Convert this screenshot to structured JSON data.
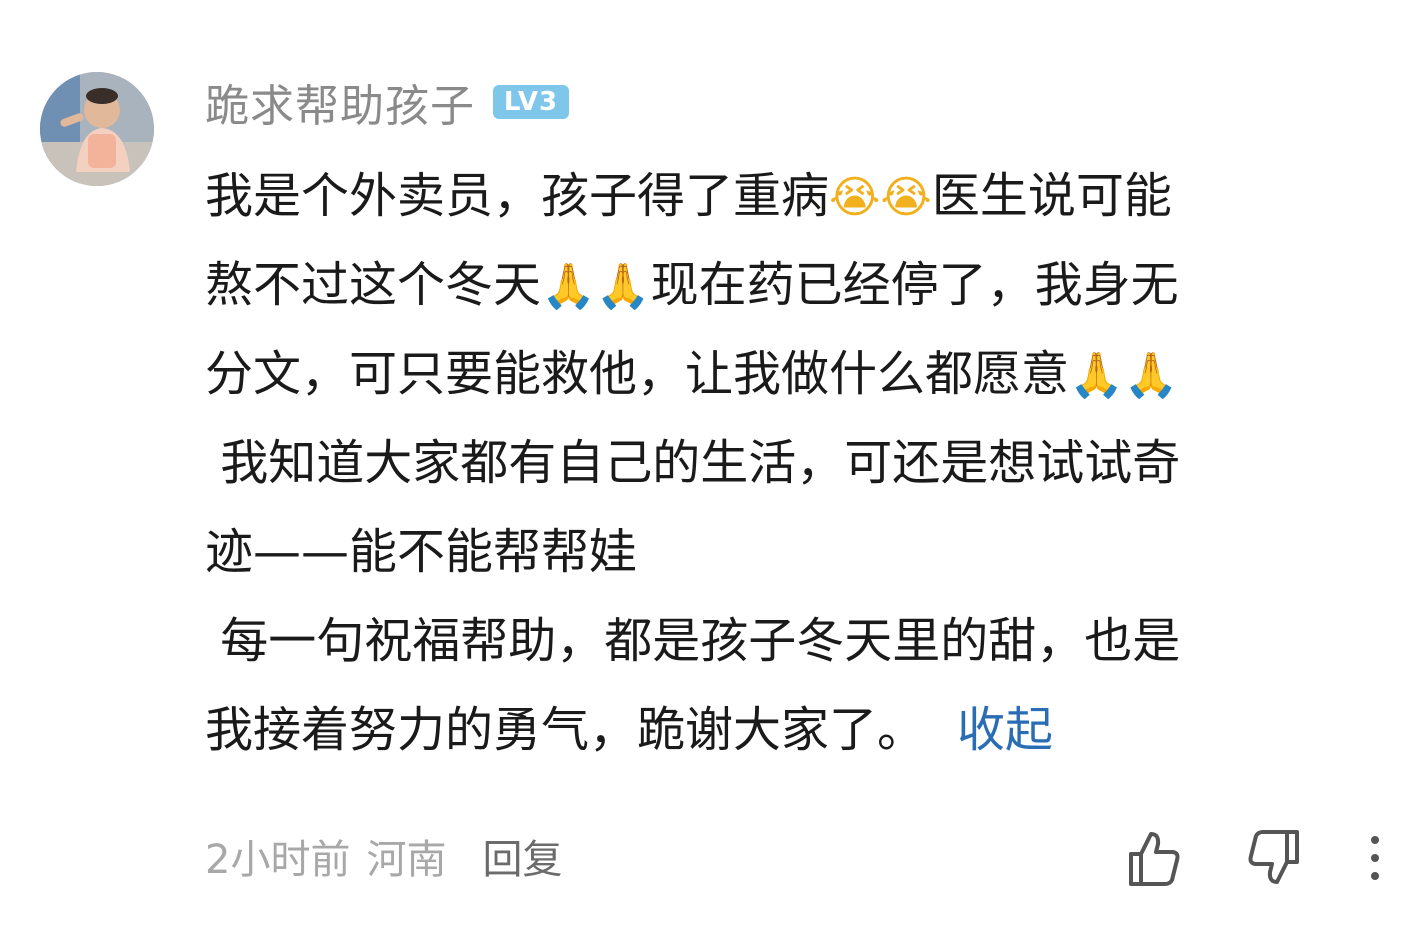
{
  "comment": {
    "username": "跪求帮助孩子",
    "level_badge": "LV3",
    "lines": [
      [
        "我是个外卖员，孩子得了重病",
        "😭😭",
        "医生说可能"
      ],
      [
        "熬不过这个冬天",
        "🙏🙏",
        "现在药已经停了，我身无"
      ],
      [
        "分文，可只要能救他，让我做什么都愿意",
        "🙏🙏",
        ""
      ],
      [
        " 我知道大家都有自己的生活，可还是想试试奇",
        "",
        ""
      ],
      [
        "迹——能不能帮帮娃",
        "",
        ""
      ],
      [
        " 每一句祝福帮助，都是孩子冬天里的甜，也是",
        "",
        ""
      ],
      [
        "我接着努力的勇气，跪谢大家了。",
        "",
        ""
      ]
    ],
    "collapse_label": "收起",
    "time": "2小时前",
    "location": "河南",
    "reply_label": "回复"
  },
  "icons": {
    "avatar": "avatar-photo",
    "like": "thumb-up-icon",
    "dislike": "thumb-down-icon",
    "more": "more-vertical-icon"
  },
  "colors": {
    "username": "#8a8a8a",
    "level_badge": "#7fc7ea",
    "body_text": "#1a1a1a",
    "link": "#2a6db5",
    "meta": "#a8a8a8",
    "reply": "#6b6b6b",
    "icon": "#555555"
  }
}
